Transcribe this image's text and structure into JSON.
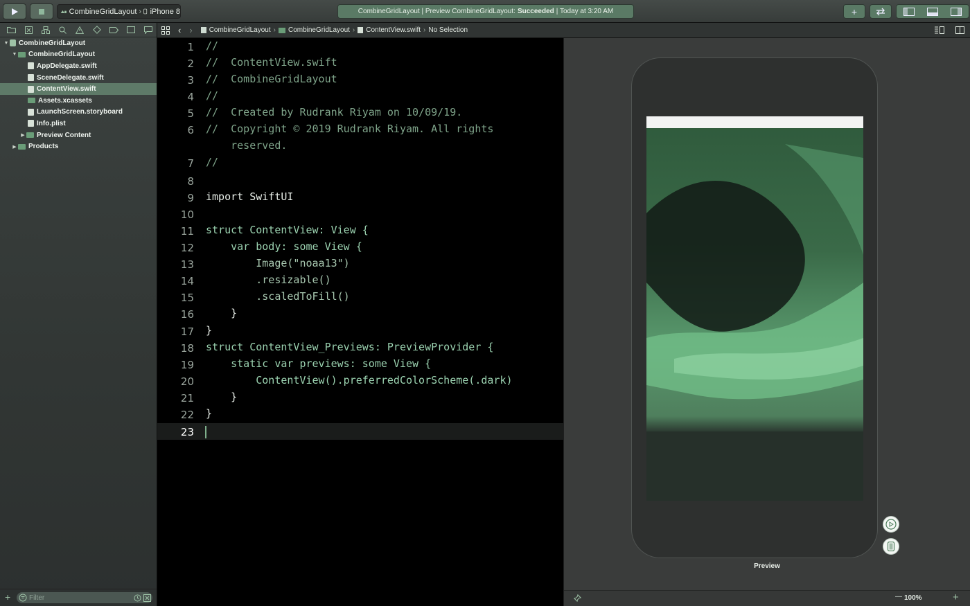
{
  "toolbar": {
    "scheme_project": "CombineGridLayout",
    "scheme_device": "iPhone 8",
    "activity_prefix": "CombineGridLayout | Preview CombineGridLayout:",
    "activity_status": "Succeeded",
    "activity_suffix": "| Today at 3:20 AM",
    "add_label": "+",
    "accent_color": "#5a7a65"
  },
  "navigator": {
    "tree": [
      {
        "label": "CombineGridLayout",
        "icon": "project-icon",
        "level": 0,
        "expanded": true
      },
      {
        "label": "CombineGridLayout",
        "icon": "folder-icon",
        "level": 1,
        "expanded": true
      },
      {
        "label": "AppDelegate.swift",
        "icon": "swift-file-icon",
        "level": 2
      },
      {
        "label": "SceneDelegate.swift",
        "icon": "swift-file-icon",
        "level": 2
      },
      {
        "label": "ContentView.swift",
        "icon": "swift-file-icon",
        "level": 2,
        "selected": true
      },
      {
        "label": "Assets.xcassets",
        "icon": "folder-icon",
        "level": 2
      },
      {
        "label": "LaunchScreen.storyboard",
        "icon": "storyboard-icon",
        "level": 2
      },
      {
        "label": "Info.plist",
        "icon": "plist-icon",
        "level": 2
      },
      {
        "label": "Preview Content",
        "icon": "folder-icon",
        "level": 2,
        "expanded": false
      },
      {
        "label": "Products",
        "icon": "folder-icon",
        "level": 1,
        "expanded": false
      }
    ],
    "filter_placeholder": "Filter"
  },
  "jumpbar": {
    "crumbs": [
      "CombineGridLayout",
      "CombineGridLayout",
      "ContentView.swift",
      "No Selection"
    ]
  },
  "editor": {
    "lines": [
      {
        "n": "1",
        "text": "//"
      },
      {
        "n": "2",
        "text": "//  ContentView.swift"
      },
      {
        "n": "3",
        "text": "//  CombineGridLayout"
      },
      {
        "n": "4",
        "text": "//"
      },
      {
        "n": "5",
        "text": "//  Created by Rudrank Riyam on 10/09/19."
      },
      {
        "n": "6",
        "text": "//  Copyright © 2019 Rudrank Riyam. All rights"
      },
      {
        "n": "",
        "text": "    reserved."
      },
      {
        "n": "7",
        "text": "//"
      },
      {
        "n": "8",
        "text": ""
      },
      {
        "n": "9",
        "text": "import SwiftUI"
      },
      {
        "n": "10",
        "text": ""
      },
      {
        "n": "11",
        "text": "struct ContentView: View {"
      },
      {
        "n": "12",
        "text": "    var body: some View {"
      },
      {
        "n": "13",
        "text": "        Image(\"noaa13\")"
      },
      {
        "n": "14",
        "text": "        .resizable()"
      },
      {
        "n": "15",
        "text": "        .scaledToFill()"
      },
      {
        "n": "16",
        "text": "    }"
      },
      {
        "n": "17",
        "text": "}"
      },
      {
        "n": "18",
        "text": "struct ContentView_Previews: PreviewProvider {"
      },
      {
        "n": "19",
        "text": "    static var previews: some View {"
      },
      {
        "n": "20",
        "text": "        ContentView().preferredColorScheme(.dark)"
      },
      {
        "n": "21",
        "text": "    }"
      },
      {
        "n": "22",
        "text": "}"
      },
      {
        "n": "23",
        "text": ""
      }
    ],
    "current_line": "23"
  },
  "canvas": {
    "preview_label": "Preview",
    "zoom": "100%",
    "zoom_minus": "—",
    "zoom_plus": "+"
  }
}
